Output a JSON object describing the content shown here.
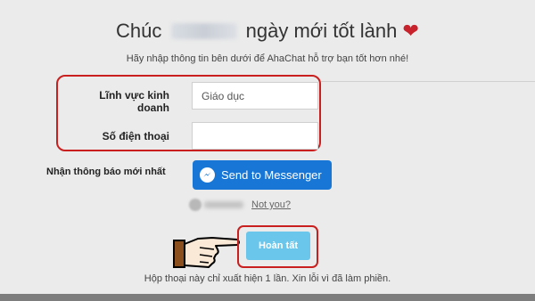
{
  "dialog": {
    "greeting_prefix": "Chúc",
    "greeting_suffix": "ngày mới tốt lành",
    "subtitle": "Hãy nhập thông tin bên dưới để AhaChat hỗ trợ bạn tốt hơn nhé!",
    "footer_note": "Hộp thoại này chỉ xuất hiện 1 lần. Xin lỗi vì đã làm phiền."
  },
  "form": {
    "business_field": {
      "label": "Lĩnh vực kinh doanh",
      "value": "Giáo dục"
    },
    "phone": {
      "label": "Số điện thoại",
      "value": ""
    }
  },
  "notify": {
    "label": "Nhận thông báo mới nhất",
    "messenger_button": "Send to Messenger",
    "not_you": "Not you?"
  },
  "submit_label": "Hoàn tất",
  "colors": {
    "highlight": "#c9201f",
    "messenger": "#1877d6",
    "submit": "#6ac6ea",
    "heart": "#c8232c"
  }
}
